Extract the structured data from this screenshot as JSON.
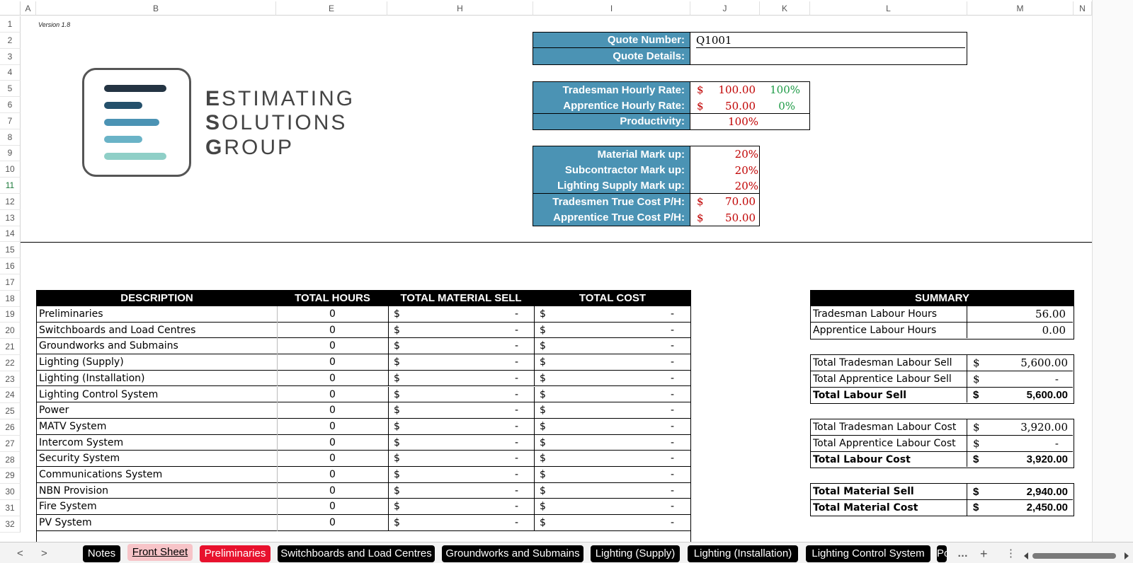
{
  "columns": [
    "A",
    "B",
    "E",
    "H",
    "I",
    "J",
    "K",
    "L",
    "M",
    "N"
  ],
  "rows": [
    "1",
    "2",
    "3",
    "4",
    "5",
    "6",
    "7",
    "8",
    "9",
    "10",
    "11",
    "12",
    "13",
    "14",
    "15",
    "16",
    "17",
    "18",
    "19",
    "20",
    "21",
    "22",
    "23",
    "24",
    "25",
    "26",
    "27",
    "28",
    "29",
    "30",
    "31",
    "32"
  ],
  "version": "Version 1.8",
  "logo": {
    "line1": "ESTIMATING",
    "line2": "SOLUTIONS",
    "line3": "GROUP"
  },
  "quote": {
    "number_label": "Quote Number:",
    "number_value": "Q1001",
    "details_label": "Quote Details:",
    "details_value": ""
  },
  "rates": {
    "tradesman_label": "Tradesman Hourly Rate:",
    "tradesman_cur": "$",
    "tradesman_value": "100.00",
    "tradesman_pct": "100%",
    "apprentice_label": "Apprentice Hourly Rate:",
    "apprentice_cur": "$",
    "apprentice_value": "50.00",
    "apprentice_pct": "0%",
    "productivity_label": "Productivity:",
    "productivity_value": "100%"
  },
  "markups": {
    "material_label": "Material Mark up:",
    "material_value": "20%",
    "subcontractor_label": "Subcontractor Mark up:",
    "subcontractor_value": "20%",
    "lighting_label": "Lighting Supply Mark up:",
    "lighting_value": "20%",
    "trades_cost_label": "Tradesmen True Cost P/H:",
    "trades_cost_cur": "$",
    "trades_cost_value": "70.00",
    "appr_cost_label": "Apprentice True Cost P/H:",
    "appr_cost_cur": "$",
    "appr_cost_value": "50.00"
  },
  "table": {
    "headers": {
      "description": "DESCRIPTION",
      "hours": "TOTAL HOURS",
      "material": "TOTAL MATERIAL SELL",
      "cost": "TOTAL COST"
    },
    "rows": [
      {
        "desc": "Preliminaries",
        "hours": "0",
        "mcur": "$",
        "mval": "-",
        "ccur": "$",
        "cval": "-"
      },
      {
        "desc": "Switchboards and Load Centres",
        "hours": "0",
        "mcur": "$",
        "mval": "-",
        "ccur": "$",
        "cval": "-"
      },
      {
        "desc": "Groundworks and Submains",
        "hours": "0",
        "mcur": "$",
        "mval": "-",
        "ccur": "$",
        "cval": "-"
      },
      {
        "desc": "Lighting (Supply)",
        "hours": "0",
        "mcur": "$",
        "mval": "-",
        "ccur": "$",
        "cval": "-"
      },
      {
        "desc": "Lighting (Installation)",
        "hours": "0",
        "mcur": "$",
        "mval": "-",
        "ccur": "$",
        "cval": "-"
      },
      {
        "desc": "Lighting Control System",
        "hours": "0",
        "mcur": "$",
        "mval": "-",
        "ccur": "$",
        "cval": "-"
      },
      {
        "desc": "Power",
        "hours": "0",
        "mcur": "$",
        "mval": "-",
        "ccur": "$",
        "cval": "-"
      },
      {
        "desc": "MATV System",
        "hours": "0",
        "mcur": "$",
        "mval": "-",
        "ccur": "$",
        "cval": "-"
      },
      {
        "desc": "Intercom System",
        "hours": "0",
        "mcur": "$",
        "mval": "-",
        "ccur": "$",
        "cval": "-"
      },
      {
        "desc": "Security System",
        "hours": "0",
        "mcur": "$",
        "mval": "-",
        "ccur": "$",
        "cval": "-"
      },
      {
        "desc": "Communications System",
        "hours": "0",
        "mcur": "$",
        "mval": "-",
        "ccur": "$",
        "cval": "-"
      },
      {
        "desc": "NBN Provision",
        "hours": "0",
        "mcur": "$",
        "mval": "-",
        "ccur": "$",
        "cval": "-"
      },
      {
        "desc": "Fire System",
        "hours": "0",
        "mcur": "$",
        "mval": "-",
        "ccur": "$",
        "cval": "-"
      },
      {
        "desc": "PV System",
        "hours": "0",
        "mcur": "$",
        "mval": "-",
        "ccur": "$",
        "cval": "-"
      }
    ]
  },
  "summary": {
    "title": "SUMMARY",
    "trades_hours_label": "Tradesman Labour Hours",
    "trades_hours_value": "56.00",
    "appr_hours_label": "Apprentice Labour Hours",
    "appr_hours_value": "0.00",
    "trades_sell_label": "Total Tradesman Labour Sell",
    "trades_sell_cur": "$",
    "trades_sell_value": "5,600.00",
    "appr_sell_label": "Total Apprentice Labour Sell",
    "appr_sell_cur": "$",
    "appr_sell_value": "-",
    "labour_sell_label": "Total Labour Sell",
    "labour_sell_cur": "$",
    "labour_sell_value": "5,600.00",
    "trades_cost_label": "Total Tradesman Labour Cost",
    "trades_cost_cur": "$",
    "trades_cost_value": "3,920.00",
    "appr_cost_label": "Total Apprentice Labour Cost",
    "appr_cost_cur": "$",
    "appr_cost_value": "-",
    "labour_cost_label": "Total Labour Cost",
    "labour_cost_cur": "$",
    "labour_cost_value": "3,920.00",
    "material_sell_label": "Total Material Sell",
    "material_sell_cur": "$",
    "material_sell_value": "2,940.00",
    "material_cost_label": "Total Material Cost",
    "material_cost_cur": "$",
    "material_cost_value": "2,450.00"
  },
  "sheet_tabs": {
    "prev": "<",
    "next": ">",
    "tabs": [
      {
        "label": "Notes",
        "style": "black"
      },
      {
        "label": "Front Sheet",
        "style": "active"
      },
      {
        "label": "Preliminaries",
        "style": "red"
      },
      {
        "label": "Switchboards and Load Centres",
        "style": "black"
      },
      {
        "label": "Groundworks and Submains",
        "style": "black"
      },
      {
        "label": "Lighting (Supply)",
        "style": "black"
      },
      {
        "label": "Lighting (Installation)",
        "style": "black"
      },
      {
        "label": "Lighting Control System",
        "style": "black"
      },
      {
        "label": "Po",
        "style": "black"
      }
    ],
    "more": "…",
    "add": "+",
    "options": "⋮"
  },
  "colors": {
    "header_blue": "#4b93b4",
    "value_red": "#c00000",
    "pct_green": "#1c9a45",
    "active_tab": "#f7c4c8",
    "red_tab": "#e8112d",
    "logo_bars": [
      "#243443",
      "#24506b",
      "#4b93b4",
      "#6ab3c7",
      "#8fcfc7"
    ]
  }
}
